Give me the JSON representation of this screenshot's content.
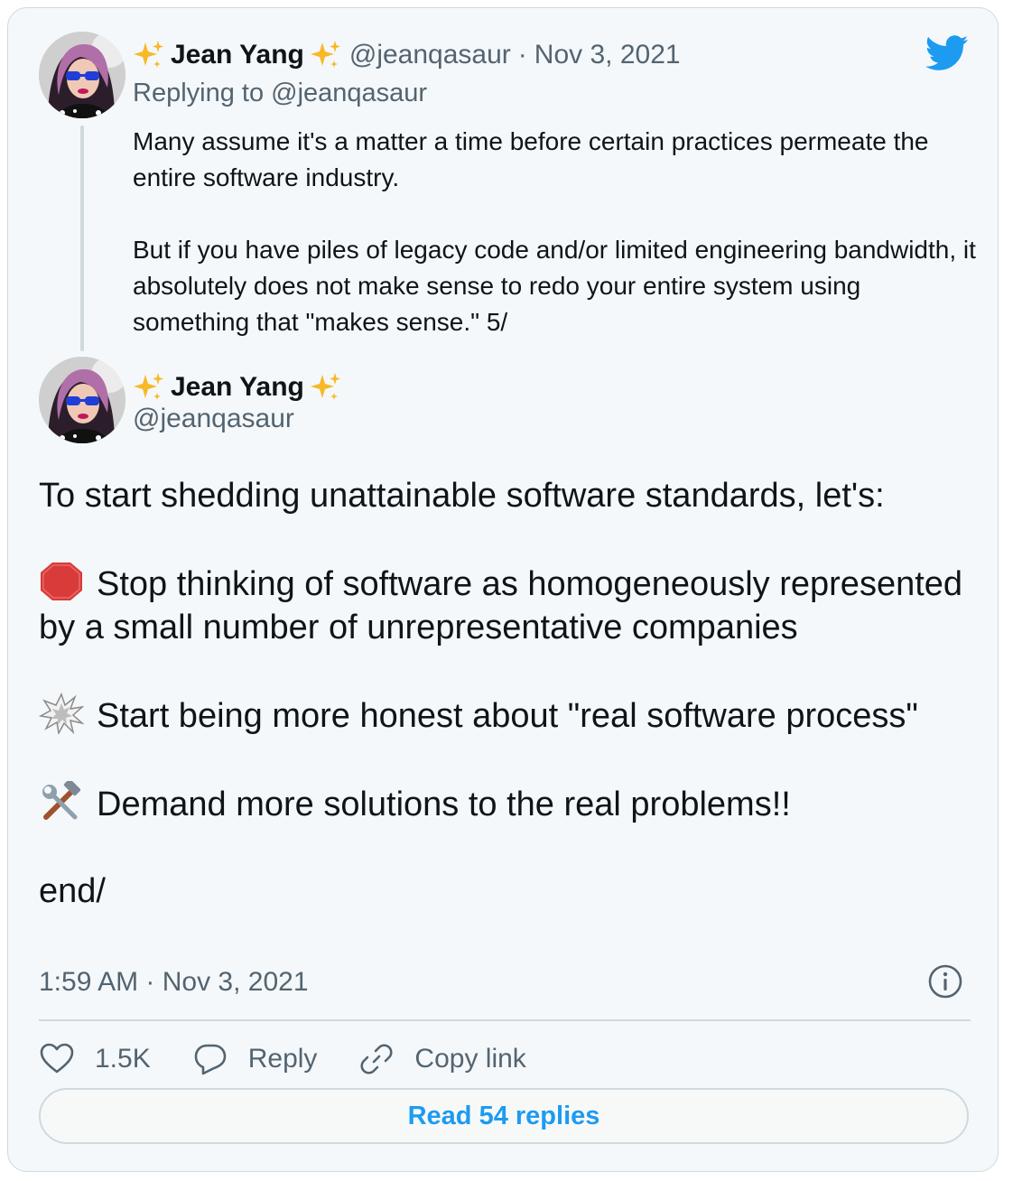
{
  "parent_tweet": {
    "display_name": "Jean Yang",
    "handle": "@jeanqasaur",
    "separator": "·",
    "date": "Nov 3, 2021",
    "replying_prefix": "Replying to",
    "replying_to": "@jeanqasaur",
    "paragraphs": [
      "Many assume it's a matter a time before certain practices permeate the entire software industry.",
      "But if you have piles of legacy code and/or limited engineering bandwidth, it absolutely does not make sense to redo your entire system using something that \"makes sense.\" 5/"
    ]
  },
  "main_tweet": {
    "display_name": "Jean Yang",
    "handle": "@jeanqasaur",
    "intro": "To start shedding unattainable software standards, let's:",
    "point1": "Stop thinking of software as homogeneously represented by a small number of unrepresentative companies",
    "point2": "Start being more honest about \"real software process\"",
    "point3": "Demand more solutions to the real problems!!",
    "outro": "end/",
    "timestamp": "1:59 AM · Nov 3, 2021"
  },
  "actions": {
    "like_count": "1.5K",
    "reply_label": "Reply",
    "copy_link_label": "Copy link",
    "read_replies_label": "Read 54 replies"
  },
  "colors": {
    "accent": "#1d9bf0",
    "secondary_text": "#536471",
    "card_background": "#f5f8fa",
    "border": "#cfd9de"
  },
  "icons": [
    "sparkles-emoji",
    "twitter-bird-icon",
    "stop-sign-emoji",
    "collision-emoji",
    "hammer-wrench-emoji",
    "info-icon",
    "heart-icon",
    "reply-bubble-icon",
    "link-icon"
  ]
}
